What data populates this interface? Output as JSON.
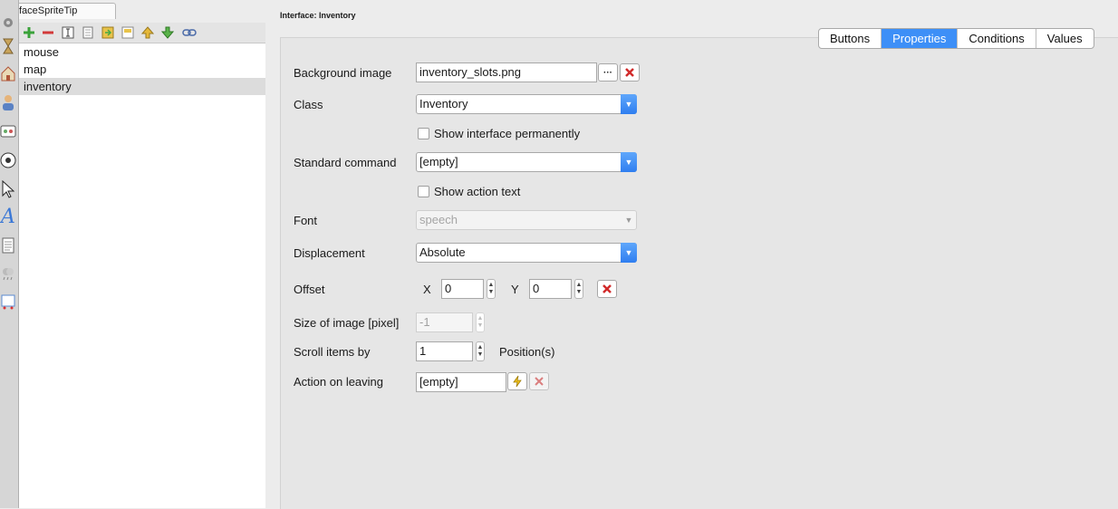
{
  "window_tab": {
    "label": "nterfaceSpriteTip"
  },
  "toolstrip": {
    "icons": [
      "gear-icon",
      "hourglass-icon",
      "house-icon",
      "person-icon",
      "gamepad-icon",
      "ball-icon",
      "cursor-icon",
      "text-icon",
      "document-icon",
      "weather-icon",
      "paint-icon"
    ]
  },
  "list_toolbar": {
    "buttons": [
      "add-icon",
      "remove-icon",
      "rename-icon",
      "copy-icon",
      "import-icon",
      "export-icon",
      "move-up-icon",
      "move-down-icon",
      "link-icon"
    ]
  },
  "list": {
    "items": [
      {
        "label": "mouse",
        "selected": false
      },
      {
        "label": "map",
        "selected": false
      },
      {
        "label": "inventory",
        "selected": true
      }
    ]
  },
  "header": {
    "title": "Interface: Inventory"
  },
  "tabs": [
    {
      "label": "Buttons",
      "active": false
    },
    {
      "label": "Properties",
      "active": true
    },
    {
      "label": "Conditions",
      "active": false
    },
    {
      "label": "Values",
      "active": false
    }
  ],
  "form": {
    "background_image": {
      "label": "Background image",
      "value": "inventory_slots.png",
      "browse": "···"
    },
    "class": {
      "label": "Class",
      "value": "Inventory"
    },
    "show_permanently": {
      "label": "Show interface permanently",
      "checked": false
    },
    "standard_command": {
      "label": "Standard command",
      "value": "[empty]"
    },
    "show_action_text": {
      "label": "Show action text",
      "checked": false
    },
    "font": {
      "label": "Font",
      "value": "speech"
    },
    "displacement": {
      "label": "Displacement",
      "value": "Absolute"
    },
    "offset": {
      "label": "Offset",
      "x_label": "X",
      "x_value": "0",
      "y_label": "Y",
      "y_value": "0"
    },
    "size_of_image": {
      "label": "Size of image [pixel]",
      "value": "-1"
    },
    "scroll_items": {
      "label": "Scroll items by",
      "value": "1",
      "unit": "Position(s)"
    },
    "action_on_leaving": {
      "label": "Action on leaving",
      "value": "[empty]"
    }
  },
  "colors": {
    "accent": "#3d8ff7",
    "delete_red": "#d12a2a",
    "selection": "#dcdcdc"
  }
}
